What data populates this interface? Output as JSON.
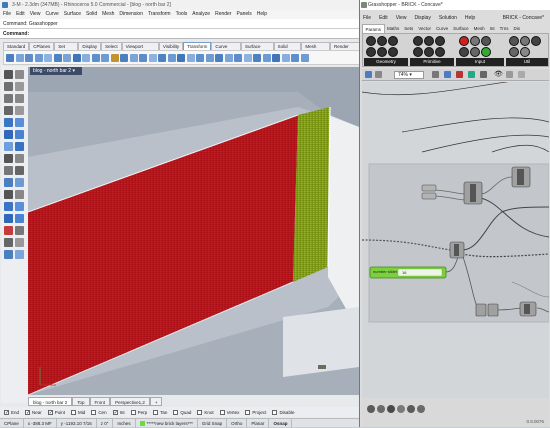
{
  "rhino": {
    "title": "3-M - 2.3dm (347MB) - Rhinoceros 5.0 Commercial - [blog - north bar 2]",
    "menu": [
      "File",
      "Edit",
      "View",
      "Curve",
      "Surface",
      "Solid",
      "Mesh",
      "Dimension",
      "Transform",
      "Tools",
      "Analyze",
      "Render",
      "Panels",
      "Help"
    ],
    "command_history": "Command: Grasshopper",
    "command_prompt": "Command:",
    "toolbar_tabs": [
      "Standard",
      "CPlanes",
      "Set View",
      "Display",
      "Select",
      "Viewport Layout",
      "Visibility",
      "Transform",
      "Curve Tools",
      "Surface Tools",
      "Solid Tools",
      "Mesh Tools",
      "Render Tools"
    ],
    "active_toolbar_tab": "Transform",
    "viewport_name": "blog - north bar 2",
    "viewport_tabs": [
      "blog - north bar 2",
      "Top",
      "Front",
      "Perspective1,2",
      "+"
    ],
    "snaps": [
      {
        "label": "End",
        "on": true
      },
      {
        "label": "Near",
        "on": true
      },
      {
        "label": "Point",
        "on": true
      },
      {
        "label": "Mid",
        "on": false
      },
      {
        "label": "Cen",
        "on": false
      },
      {
        "label": "Int",
        "on": true
      },
      {
        "label": "Perp",
        "on": false
      },
      {
        "label": "Tan",
        "on": false
      },
      {
        "label": "Quad",
        "on": false
      },
      {
        "label": "Knot",
        "on": false
      },
      {
        "label": "Vertex",
        "on": false
      },
      {
        "label": "Project",
        "on": false
      },
      {
        "label": "Disable",
        "on": false
      }
    ],
    "status": {
      "cplane": "CPlane",
      "x": "x -388.3 MF",
      "y": "y -1193.10 7/16",
      "z": "z 0\"",
      "units": "Inches",
      "layer": "*****new brick layers***",
      "grid_snap": "Grid Snap",
      "ortho": "Ortho",
      "planar": "Planar",
      "osnap": "Osnap"
    },
    "colors": {
      "wall_red": "#c0161a",
      "wall_green": "#8aa51c",
      "layer_swatch": "#6bdc38"
    }
  },
  "grasshopper": {
    "title": "Grasshopper - BRICK - Concave*",
    "menu": [
      "File",
      "Edit",
      "View",
      "Display",
      "Solution",
      "Help"
    ],
    "document_name": "BRICK - Concave*",
    "tabs": [
      "Params",
      "Maths",
      "Sets",
      "Vector",
      "Curve",
      "Surface",
      "Mesh",
      "Int",
      "Trns",
      "Dis"
    ],
    "active_tab": "Params",
    "ribbon_groups": [
      "Geometry",
      "Primitive",
      "Input",
      "Util"
    ],
    "zoom": "74%",
    "panel_text": "number slider",
    "panel_value": "16",
    "version": "0.9.0076"
  }
}
